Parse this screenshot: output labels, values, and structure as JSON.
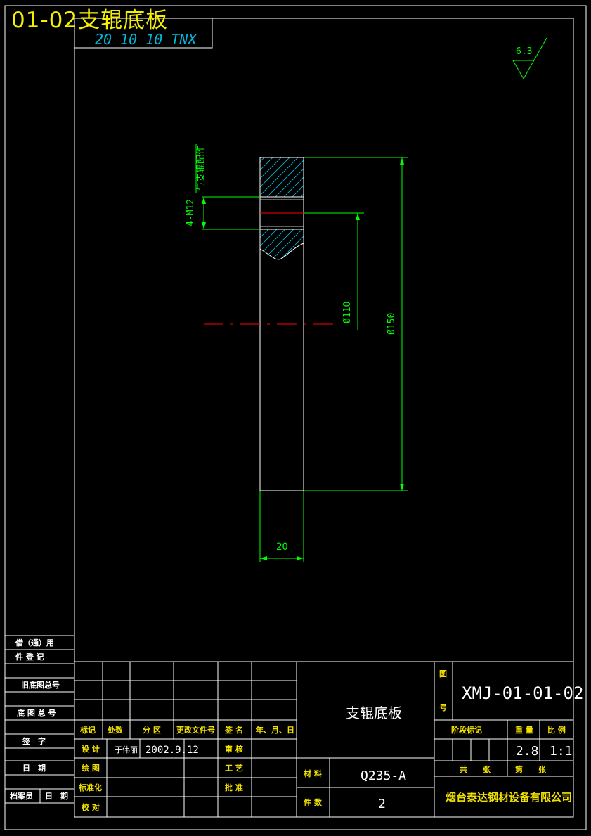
{
  "drawing_title": "01-02支辊底板",
  "top_left_box_text": "20 10 10 TNX",
  "surface_finish": "6.3",
  "annotations": {
    "mate_note": "与支辊配作",
    "thread": "4-M12",
    "dia_inner": "Ø110",
    "dia_outer": "Ø150",
    "thickness": "20"
  },
  "left_stamp": {
    "row1a": "借（通）用",
    "row1b": "件 登 记",
    "row2": "旧底图总号",
    "row3": "底 图 总 号",
    "row4": "签　字",
    "row5": "日　期",
    "row6a": "档案员",
    "row6b": "日　期"
  },
  "title_block": {
    "headers": {
      "mark": "标记",
      "count": "处数",
      "zone": "分 区",
      "change_doc": "更改文件号",
      "sign": "签 名",
      "date": "年、月、日"
    },
    "design": "设 计",
    "designer": "于伟丽",
    "design_date": "2002.9.12",
    "review": "审 核",
    "drawing": "绘 图",
    "process": "工 艺",
    "standard": "标准化",
    "approve": "批 准",
    "check": "校 对",
    "part_name": "支辊底板",
    "material_label": "材 料",
    "material": "Q235-A",
    "qty_label": "件 数",
    "qty": "2",
    "drawing_no_label_a": "图",
    "drawing_no_label_b": "号",
    "drawing_no": "XMJ-01-01-02",
    "stage_mark": "阶段标记",
    "weight_label": "重 量",
    "scale_label": "比 例",
    "weight": "2.8",
    "scale": "1:1",
    "total_sheets": "共　　张",
    "sheet_no": "第　　张",
    "company": "烟台泰达钢材设备有限公司"
  },
  "colors": {
    "background": "#000000",
    "outline": "#ffffff",
    "dimension": "#00ff00",
    "hatch": "#00b8d8",
    "centerline": "#ff0000",
    "title_overlay": "#f5f000",
    "label_yellow": "#f0e000"
  }
}
